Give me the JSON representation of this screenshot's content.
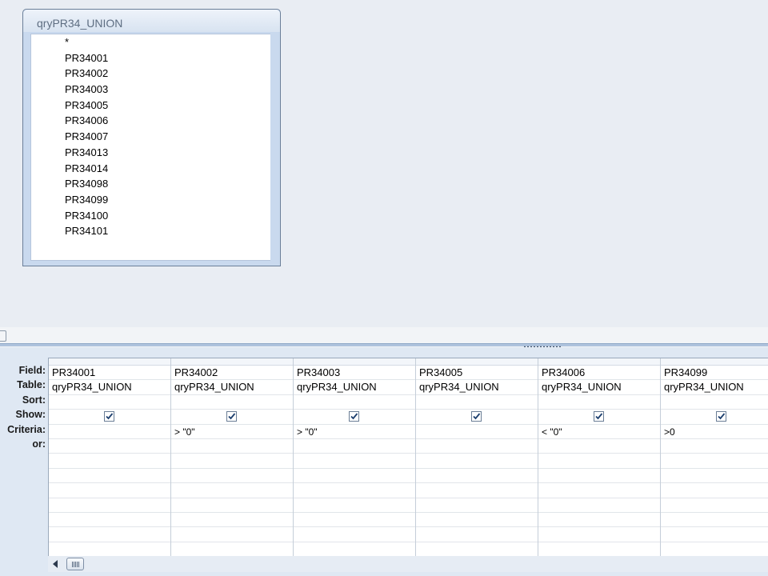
{
  "table_window": {
    "title": "qryPR34_UNION",
    "fields": [
      "*",
      "PR34001",
      "PR34002",
      "PR34003",
      "PR34005",
      "PR34006",
      "PR34007",
      "PR34013",
      "PR34014",
      "PR34098",
      "PR34099",
      "PR34100",
      "PR34101"
    ]
  },
  "grid": {
    "row_labels": [
      "Field:",
      "Table:",
      "Sort:",
      "Show:",
      "Criteria:",
      "or:"
    ],
    "columns": [
      {
        "field": "PR34001",
        "table": "qryPR34_UNION",
        "sort": "",
        "show": true,
        "criteria": "",
        "or": ""
      },
      {
        "field": "PR34002",
        "table": "qryPR34_UNION",
        "sort": "",
        "show": true,
        "criteria": "> \"0\"",
        "or": ""
      },
      {
        "field": "PR34003",
        "table": "qryPR34_UNION",
        "sort": "",
        "show": true,
        "criteria": "> \"0\"",
        "or": ""
      },
      {
        "field": "PR34005",
        "table": "qryPR34_UNION",
        "sort": "",
        "show": true,
        "criteria": "",
        "or": ""
      },
      {
        "field": "PR34006",
        "table": "qryPR34_UNION",
        "sort": "",
        "show": true,
        "criteria": "< \"0\"",
        "or": ""
      },
      {
        "field": "PR34099",
        "table": "qryPR34_UNION",
        "sort": "",
        "show": true,
        "criteria": ">0",
        "or": ""
      }
    ]
  },
  "colors": {
    "pane_background": "#e9edf3",
    "grid_background": "#dfe8f3",
    "splitter": "#aec3dd",
    "checkmark": "#1d3f6e"
  },
  "icons": {
    "checkbox": "checkmark-icon",
    "scroll_left": "triangle-left-icon",
    "scroll_thumb": "grip-lines-icon"
  }
}
